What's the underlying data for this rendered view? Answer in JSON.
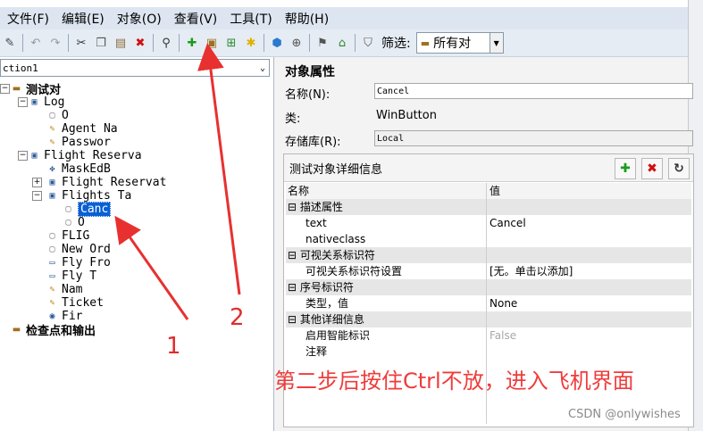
{
  "menu": [
    "文件(F)",
    "编辑(E)",
    "对象(O)",
    "查看(V)",
    "工具(T)",
    "帮助(H)"
  ],
  "toolbar": {
    "filter_label": "筛选:",
    "filter_value": "所有对"
  },
  "left": {
    "combo_value": "ction1",
    "tree": {
      "root": "测试对",
      "log": "Log",
      "log_o": "O",
      "agent": "Agent Na",
      "password": "Passwor",
      "flight_res": "Flight Reserva",
      "maskedb": "MaskEdB",
      "flight_reservat": "Flight Reservat",
      "flights_ta": "Flights Ta",
      "canc": "Canc",
      "o2": "O",
      "flig": "FLIG",
      "new_ord": "New Ord",
      "fly_fro": "Fly Fro",
      "fly_t": "Fly T",
      "nam": "Nam",
      "ticket": "Ticket",
      "fir": "Fir",
      "checkpoints": "检查点和输出"
    }
  },
  "right": {
    "title": "对象属性",
    "name_label": "名称(N):",
    "name_value": "Cancel",
    "class_label": "类:",
    "class_value": "WinButton",
    "repo_label": "存储库(R):",
    "repo_value": "Local",
    "detail_title": "测试对象详细信息",
    "grid": {
      "col_name": "名称",
      "col_value": "值",
      "cat1": "描述属性",
      "r_text": "text",
      "r_text_v": "Cancel",
      "r_native": "nativeclass",
      "cat2": "可视关系标识符",
      "r_vis": "可视关系标识符设置",
      "r_vis_v": "[无。单击以添加]",
      "cat3": "序号标识符",
      "r_type": "类型，值",
      "r_type_v": "None",
      "cat4": "其他详细信息",
      "r_smart": "启用智能标识",
      "r_smart_v": "False",
      "r_comment": "注释"
    }
  },
  "annotation": {
    "note": "第二步后按住Ctrl不放，进入飞机界面",
    "label1": "1",
    "label2": "2",
    "color": "#f03c3c"
  },
  "watermark": "CSDN @onlywishes"
}
